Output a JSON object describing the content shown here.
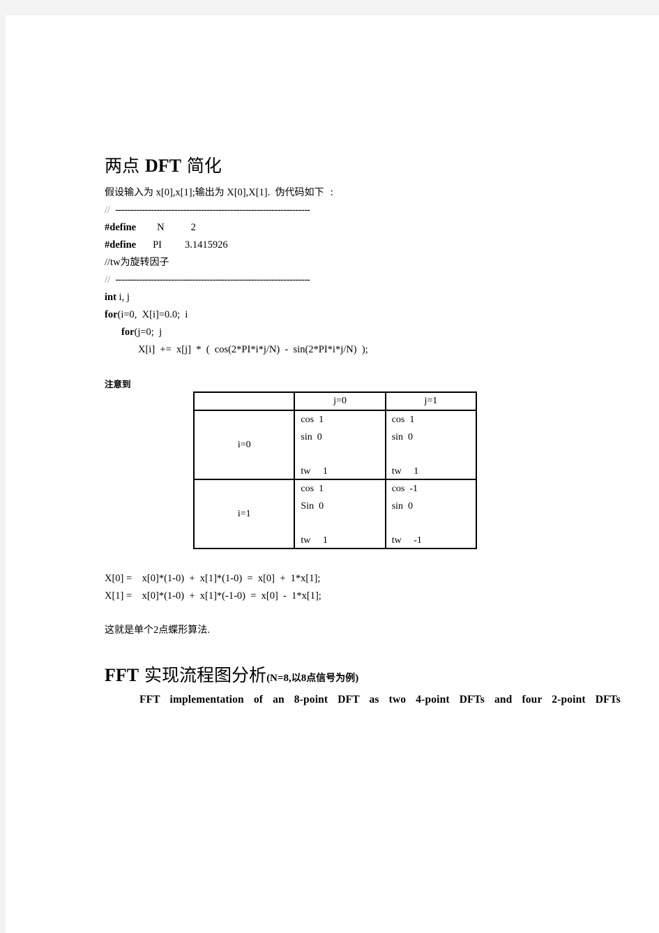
{
  "section1": {
    "title_zh_1": "两点",
    "title_en": "DFT",
    "title_zh_2": "简化",
    "intro": {
      "zh_1": "假设输入为",
      "en_1": " x[0],x[1];",
      "zh_2": "输出为",
      "en_2": " X[0],X[1].  ",
      "zh_3": "伪代码如下  :"
    },
    "code": {
      "comment_prefix": "//",
      "separator": "------------------------------------------------------------------",
      "define1": {
        "kw": "#define",
        "name": "N",
        "value": "2"
      },
      "define2": {
        "kw": "#define",
        "name": "PI",
        "value": "3.1415926"
      },
      "tw_comment_en": "//tw",
      "tw_comment_zh": "为旋转因子",
      "int_kw": "int",
      "int_rest": " i, j",
      "for1_kw": "for",
      "for1_rest": "(i=0,  X[i]=0.0;  i",
      "for2_kw": "for",
      "for2_rest": "(j=0;  j",
      "stmt": "X[i]  +=  x[j]  *  (  cos(2*PI*i*j/N)  -  sin(2*PI*i*j/N)  );"
    },
    "note_label": "注意到",
    "table": {
      "headers": [
        "",
        "j=0",
        "j=1"
      ],
      "rows": [
        {
          "label": "i=0",
          "cells": [
            {
              "cos": "cos  1",
              "sin": "sin  0",
              "tw": "tw     1"
            },
            {
              "cos": "cos  1",
              "sin": "sin  0",
              "tw": "tw     1"
            }
          ]
        },
        {
          "label": "i=1",
          "cells": [
            {
              "cos": "cos  1",
              "sin": "Sin  0",
              "tw": "tw     1"
            },
            {
              "cos": "cos  -1",
              "sin": "sin  0",
              "tw": "tw     -1"
            }
          ]
        }
      ]
    },
    "equations": [
      "X[0] =    x[0]*(1-0)  +  x[1]*(1-0)  =  x[0]  +  1*x[1];",
      "X[1] =    x[0]*(1-0)  +  x[1]*(-1-0)  =  x[0]  -  1*x[1];"
    ],
    "conclusion_zh_1": "这就是单个",
    "conclusion_num": "2",
    "conclusion_zh_2": "点蝶形算法",
    "conclusion_end": "."
  },
  "section2": {
    "title_en": "FFT",
    "title_zh": " 实现流程图分析",
    "paren_open": "(N=8,",
    "paren_zh_1": "以",
    "paren_num": "8",
    "paren_zh_2": "点信号为例",
    "paren_close": ")",
    "figure_caption": "FFT  implementation  of  an  8-point  DFT  as  two  4-point  DFTs  and  four  2-point  DFTs"
  }
}
